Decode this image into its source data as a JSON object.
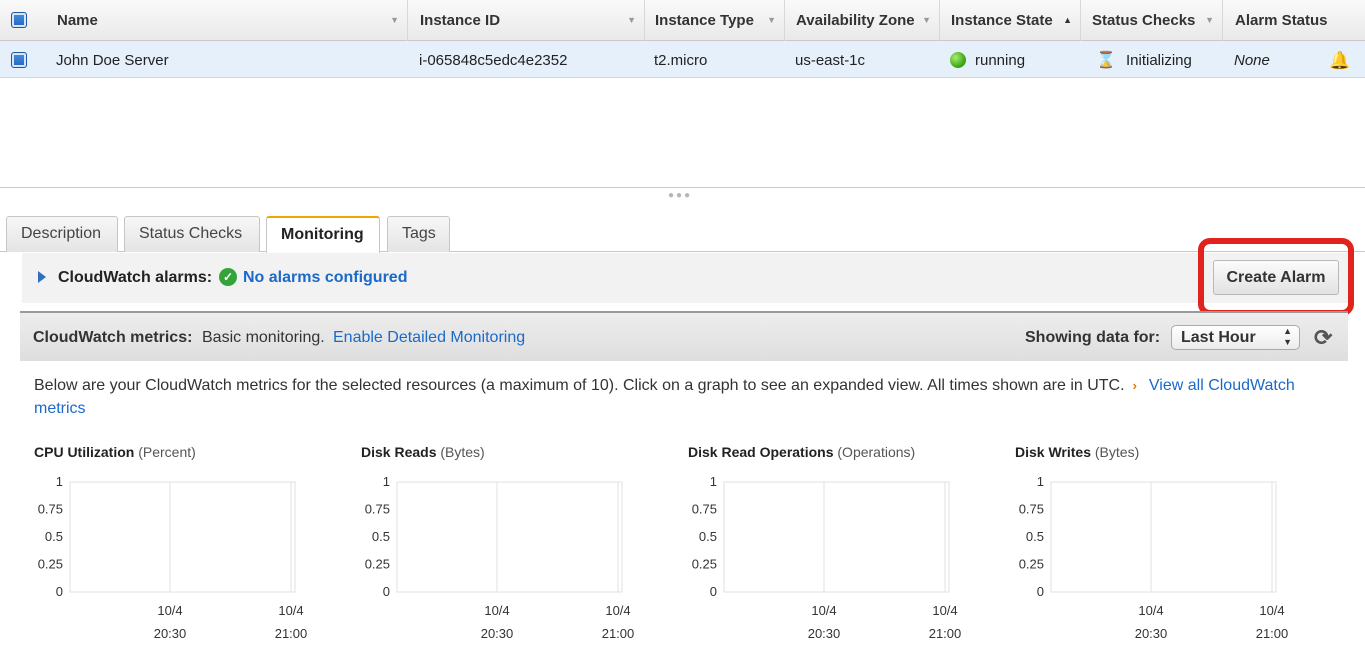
{
  "table": {
    "columns": [
      "Name",
      "Instance ID",
      "Instance Type",
      "Availability Zone",
      "Instance State",
      "Status Checks",
      "Alarm Status"
    ],
    "row": {
      "name": "John Doe Server",
      "instance_id": "i-065848c5edc4e2352",
      "instance_type": "t2.micro",
      "availability_zone": "us-east-1c",
      "instance_state": "running",
      "status_checks": "Initializing",
      "alarm_status": "None"
    }
  },
  "tabs": [
    "Description",
    "Status Checks",
    "Monitoring",
    "Tags"
  ],
  "active_tab": "Monitoring",
  "alarms": {
    "label": "CloudWatch alarms:",
    "status": "No alarms configured",
    "create_button": "Create Alarm"
  },
  "metrics_bar": {
    "label": "CloudWatch metrics:",
    "mode": "Basic monitoring.",
    "link": "Enable Detailed Monitoring",
    "showing_label": "Showing data for:",
    "range": "Last Hour"
  },
  "description": {
    "text": "Below are your CloudWatch metrics for the selected resources (a maximum of 10). Click on a graph to see an expanded view. All times shown are in UTC.",
    "link": "View all CloudWatch metrics"
  },
  "chart_data": [
    {
      "type": "line",
      "title": "CPU Utilization",
      "unit": "(Percent)",
      "y_ticks": [
        "1",
        "0.75",
        "0.5",
        "0.25",
        "0"
      ],
      "ylim": [
        0,
        1
      ],
      "x_ticks": [
        [
          "10/4",
          "20:30"
        ],
        [
          "10/4",
          "21:00"
        ]
      ],
      "series": []
    },
    {
      "type": "line",
      "title": "Disk Reads",
      "unit": "(Bytes)",
      "y_ticks": [
        "1",
        "0.75",
        "0.5",
        "0.25",
        "0"
      ],
      "ylim": [
        0,
        1
      ],
      "x_ticks": [
        [
          "10/4",
          "20:30"
        ],
        [
          "10/4",
          "21:00"
        ]
      ],
      "series": []
    },
    {
      "type": "line",
      "title": "Disk Read Operations",
      "unit": "(Operations)",
      "y_ticks": [
        "1",
        "0.75",
        "0.5",
        "0.25",
        "0"
      ],
      "ylim": [
        0,
        1
      ],
      "x_ticks": [
        [
          "10/4",
          "20:30"
        ],
        [
          "10/4",
          "21:00"
        ]
      ],
      "series": []
    },
    {
      "type": "line",
      "title": "Disk Writes",
      "unit": "(Bytes)",
      "y_ticks": [
        "1",
        "0.75",
        "0.5",
        "0.25",
        "0"
      ],
      "ylim": [
        0,
        1
      ],
      "x_ticks": [
        [
          "10/4",
          "20:30"
        ],
        [
          "10/4",
          "21:00"
        ]
      ],
      "series": []
    }
  ],
  "colors": {
    "link": "#1b6ac9",
    "highlight": "#e0231c",
    "running": "#3aa514",
    "tab_accent": "#f0a500"
  },
  "icons": [
    "checkbox-icon",
    "sort-arrow-icon",
    "running-status-icon",
    "hourglass-icon",
    "alarm-bell-icon",
    "expand-caret-icon",
    "ok-check-icon",
    "refresh-icon"
  ]
}
